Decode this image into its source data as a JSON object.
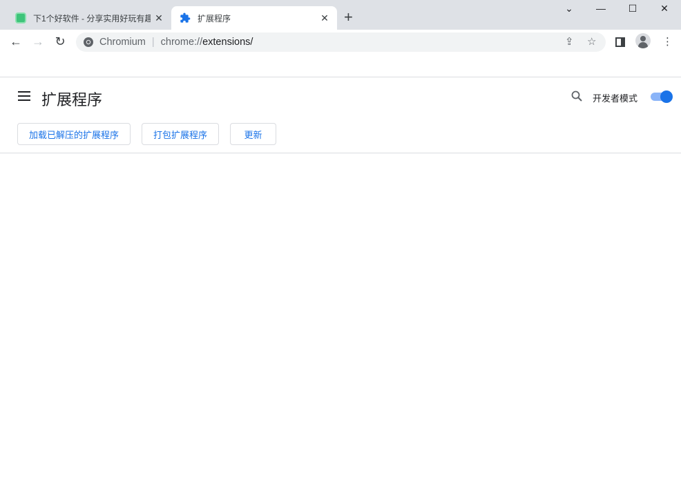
{
  "tabs": [
    {
      "title": "下1个好软件 - 分享实用好玩有趣",
      "icon": "site-favicon-icon",
      "active": false
    },
    {
      "title": "扩展程序",
      "icon": "puzzle-piece-icon",
      "active": true
    }
  ],
  "toolbar": {
    "site_name": "Chromium",
    "url_prefix": "chrome://",
    "url_host": "extensions/"
  },
  "page": {
    "title": "扩展程序",
    "developer_mode_label": "开发者模式",
    "developer_mode": true,
    "buttons": [
      "加载已解压的扩展程序",
      "打包扩展程序",
      "更新"
    ]
  },
  "colors": {
    "accent": "#1a73e8",
    "tabstrip": "#dee1e6"
  }
}
